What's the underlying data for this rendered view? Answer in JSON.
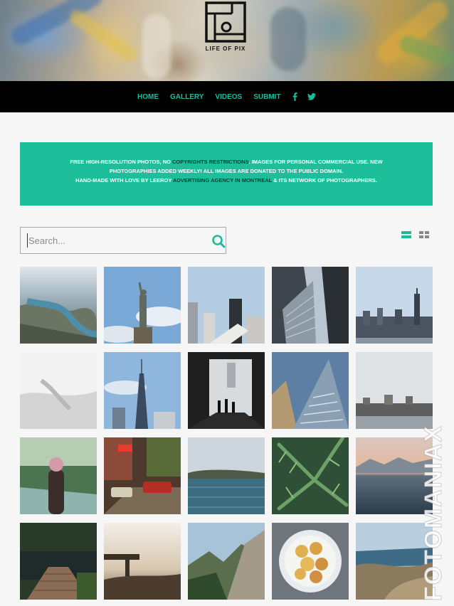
{
  "brand": {
    "name": "LIFE OF PIX"
  },
  "nav": {
    "items": [
      "HOME",
      "GALLERY",
      "VIDEOS",
      "SUBMIT"
    ],
    "social": [
      "facebook-icon",
      "twitter-icon"
    ]
  },
  "banner": {
    "l1_a": "FREE HIGH-RESOLUTION PHOTOS, NO ",
    "l1_link": "COPYRIGHTS RESTRICTIONS",
    "l1_b": ". IMAGES FOR PERSONAL COMMERCIAL USE. NEW",
    "l2": "PHOTOGRAPHIES ADDED WEEKLY! ALL IMAGES ARE DONATED TO THE PUBLIC DOMAIN.",
    "l3_a": "HAND-MADE WITH LOVE BY LEEROY ",
    "l3_link": "ADVERTISING AGENCY IN MONTREAL",
    "l3_b": " & ITS NETWORK OF PHOTOGRAPHERS."
  },
  "search": {
    "placeholder": "Search..."
  },
  "view": {
    "active": "list",
    "accent": "#1abc9c",
    "inactive": "#888888"
  },
  "watermark": "FOTOMANIAX",
  "colors": {
    "accent": "#1abc9c",
    "banner": "#1dbf9b",
    "nav_bg": "#000000"
  }
}
